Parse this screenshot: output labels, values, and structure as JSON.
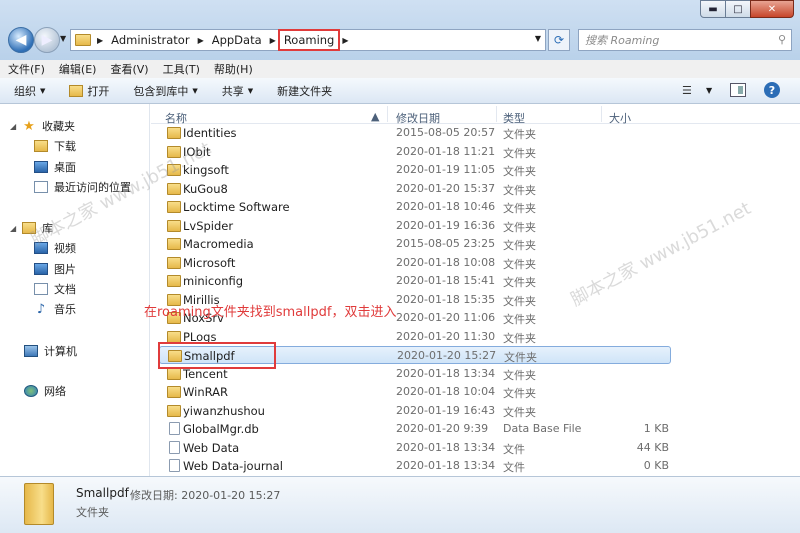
{
  "window": {
    "min_label": "▬",
    "max_label": "□",
    "close_label": "✕"
  },
  "address": {
    "crumbs": [
      "Administrator",
      "AppData",
      "Roaming"
    ],
    "search_placeholder": "搜索 Roaming"
  },
  "menu": [
    "文件(F)",
    "编辑(E)",
    "查看(V)",
    "工具(T)",
    "帮助(H)"
  ],
  "commands": {
    "organize": "组织",
    "open": "打开",
    "include": "包含到库中",
    "share": "共享",
    "new_folder": "新建文件夹"
  },
  "nav": {
    "favorites": "收藏夹",
    "downloads": "下载",
    "desktop": "桌面",
    "recent": "最近访问的位置",
    "libraries": "库",
    "videos": "视频",
    "pictures": "图片",
    "documents": "文档",
    "music": "音乐",
    "computer": "计算机",
    "network": "网络"
  },
  "columns": {
    "name": "名称",
    "date": "修改日期",
    "type": "类型",
    "size": "大小"
  },
  "files": [
    {
      "name": "Identities",
      "date": "2015-08-05 20:57",
      "type": "文件夹",
      "size": ""
    },
    {
      "name": "IObit",
      "date": "2020-01-18 11:21",
      "type": "文件夹",
      "size": ""
    },
    {
      "name": "kingsoft",
      "date": "2020-01-19 11:05",
      "type": "文件夹",
      "size": ""
    },
    {
      "name": "KuGou8",
      "date": "2020-01-20 15:37",
      "type": "文件夹",
      "size": ""
    },
    {
      "name": "Locktime Software",
      "date": "2020-01-18 10:46",
      "type": "文件夹",
      "size": ""
    },
    {
      "name": "LvSpider",
      "date": "2020-01-19 16:36",
      "type": "文件夹",
      "size": ""
    },
    {
      "name": "Macromedia",
      "date": "2015-08-05 23:25",
      "type": "文件夹",
      "size": ""
    },
    {
      "name": "Microsoft",
      "date": "2020-01-18 10:08",
      "type": "文件夹",
      "size": ""
    },
    {
      "name": "miniconfig",
      "date": "2020-01-18 15:41",
      "type": "文件夹",
      "size": ""
    },
    {
      "name": "Mirillis",
      "date": "2020-01-18 15:35",
      "type": "文件夹",
      "size": ""
    },
    {
      "name": "NoxSrv",
      "date": "2020-01-20 11:06",
      "type": "文件夹",
      "size": ""
    },
    {
      "name": "PLogs",
      "date": "2020-01-20 11:30",
      "type": "文件夹",
      "size": ""
    },
    {
      "name": "Smallpdf",
      "date": "2020-01-20 15:27",
      "type": "文件夹",
      "size": ""
    },
    {
      "name": "Tencent",
      "date": "2020-01-18 13:34",
      "type": "文件夹",
      "size": ""
    },
    {
      "name": "WinRAR",
      "date": "2020-01-18 10:04",
      "type": "文件夹",
      "size": ""
    },
    {
      "name": "yiwanzhushou",
      "date": "2020-01-19 16:43",
      "type": "文件夹",
      "size": ""
    },
    {
      "name": "GlobalMgr.db",
      "date": "2020-01-20 9:39",
      "type": "Data Base File",
      "size": "1 KB"
    },
    {
      "name": "Web Data",
      "date": "2020-01-18 13:34",
      "type": "文件",
      "size": "44 KB"
    },
    {
      "name": "Web Data-journal",
      "date": "2020-01-18 13:34",
      "type": "文件",
      "size": "0 KB"
    }
  ],
  "annotation": "在roaming文件夹找到smallpdf，双击进入",
  "details": {
    "name": "Smallpdf",
    "modified": "修改日期: 2020-01-20 15:27",
    "type": "文件夹"
  },
  "watermark": "脚本之家 www.jb51.net"
}
